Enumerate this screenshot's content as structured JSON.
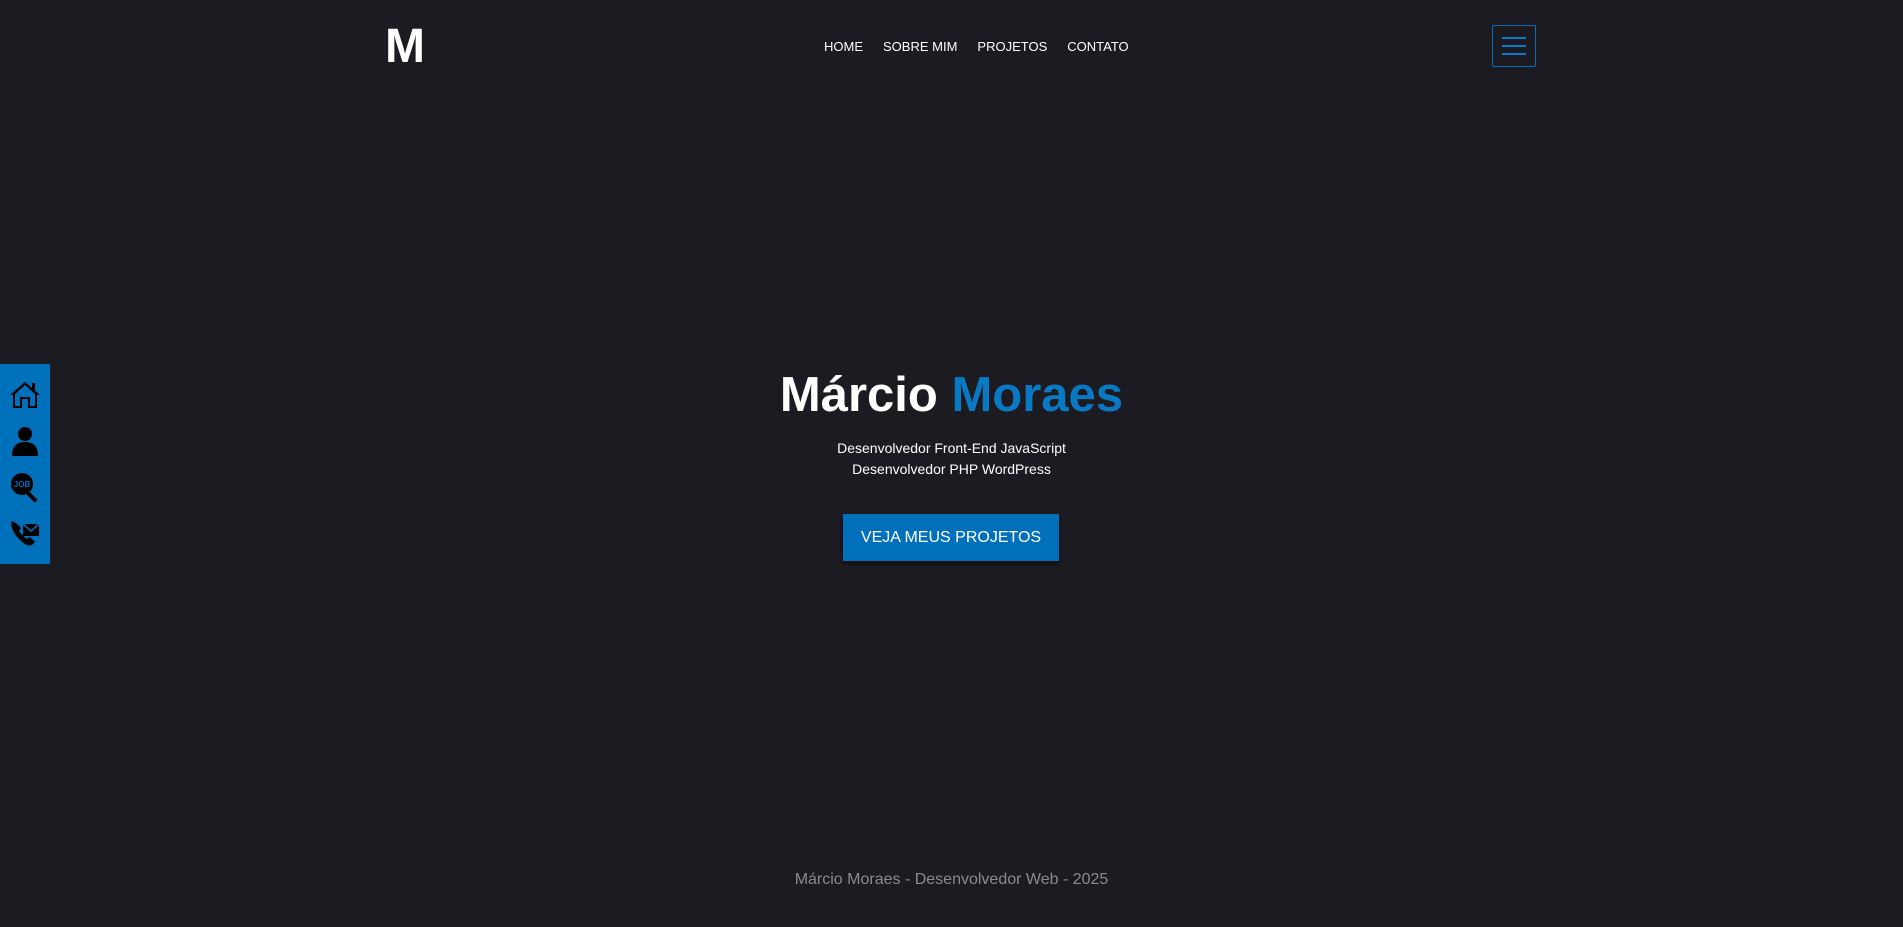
{
  "header": {
    "logo": "M",
    "nav": [
      {
        "label": "HOME"
      },
      {
        "label": "SOBRE MIM"
      },
      {
        "label": "PROJETOS"
      },
      {
        "label": "CONTATO"
      }
    ],
    "menu_icon": "hamburger-menu-icon"
  },
  "side_bar": {
    "icons": [
      {
        "name": "home-icon"
      },
      {
        "name": "user-icon"
      },
      {
        "name": "job-search-icon",
        "label": "JOB"
      },
      {
        "name": "phone-mail-icon"
      }
    ]
  },
  "hero": {
    "first_name": "Márcio",
    "last_name": "Moraes",
    "subtitle_line1": "Desenvolvedor Front-End JavaScript",
    "subtitle_line2": "Desenvolvedor PHP WordPress",
    "cta_label": "VEJA MEUS PROJETOS"
  },
  "footer": {
    "text": "Márcio Moraes - Desenvolvedor Web - 2025"
  },
  "colors": {
    "background": "#1c1b21",
    "accent": "#0070ba",
    "accent_text": "#0a79c4",
    "footer_text": "#8a8a8e"
  }
}
